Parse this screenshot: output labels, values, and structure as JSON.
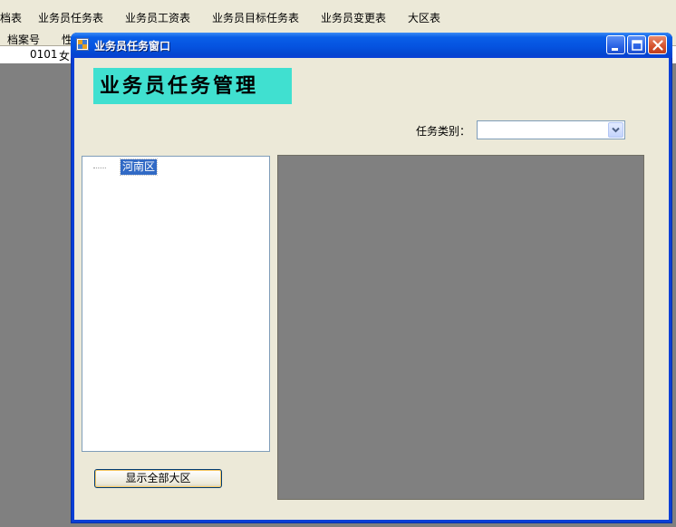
{
  "menu": {
    "items": [
      "档表",
      "业务员任务表",
      "业务员工资表",
      "业务员目标任务表",
      "业务员变更表",
      "大区表"
    ]
  },
  "background_grid": {
    "headers": [
      "档案号",
      "性"
    ],
    "row": [
      "0101",
      "女"
    ]
  },
  "window": {
    "title": "业务员任务窗口",
    "buttons": [
      "minimize",
      "maximize",
      "close"
    ]
  },
  "banner": {
    "text": "业务员任务管理"
  },
  "filter": {
    "label": "任务类别：",
    "value": ""
  },
  "tree": {
    "nodes": [
      {
        "label": "河南区",
        "selected": true
      }
    ]
  },
  "actions": {
    "show_all_label": "显示全部大区"
  },
  "colors": {
    "title_bar": "#0553e0",
    "banner_bg": "#40e0d0",
    "selection": "#316ac5",
    "client_bg": "#ece9d8",
    "mdi_bg": "#808080"
  },
  "icons": {
    "app": "app-window-icon",
    "minimize": "minimize-icon",
    "maximize": "maximize-icon",
    "close": "close-icon",
    "dropdown": "chevron-down-icon"
  }
}
